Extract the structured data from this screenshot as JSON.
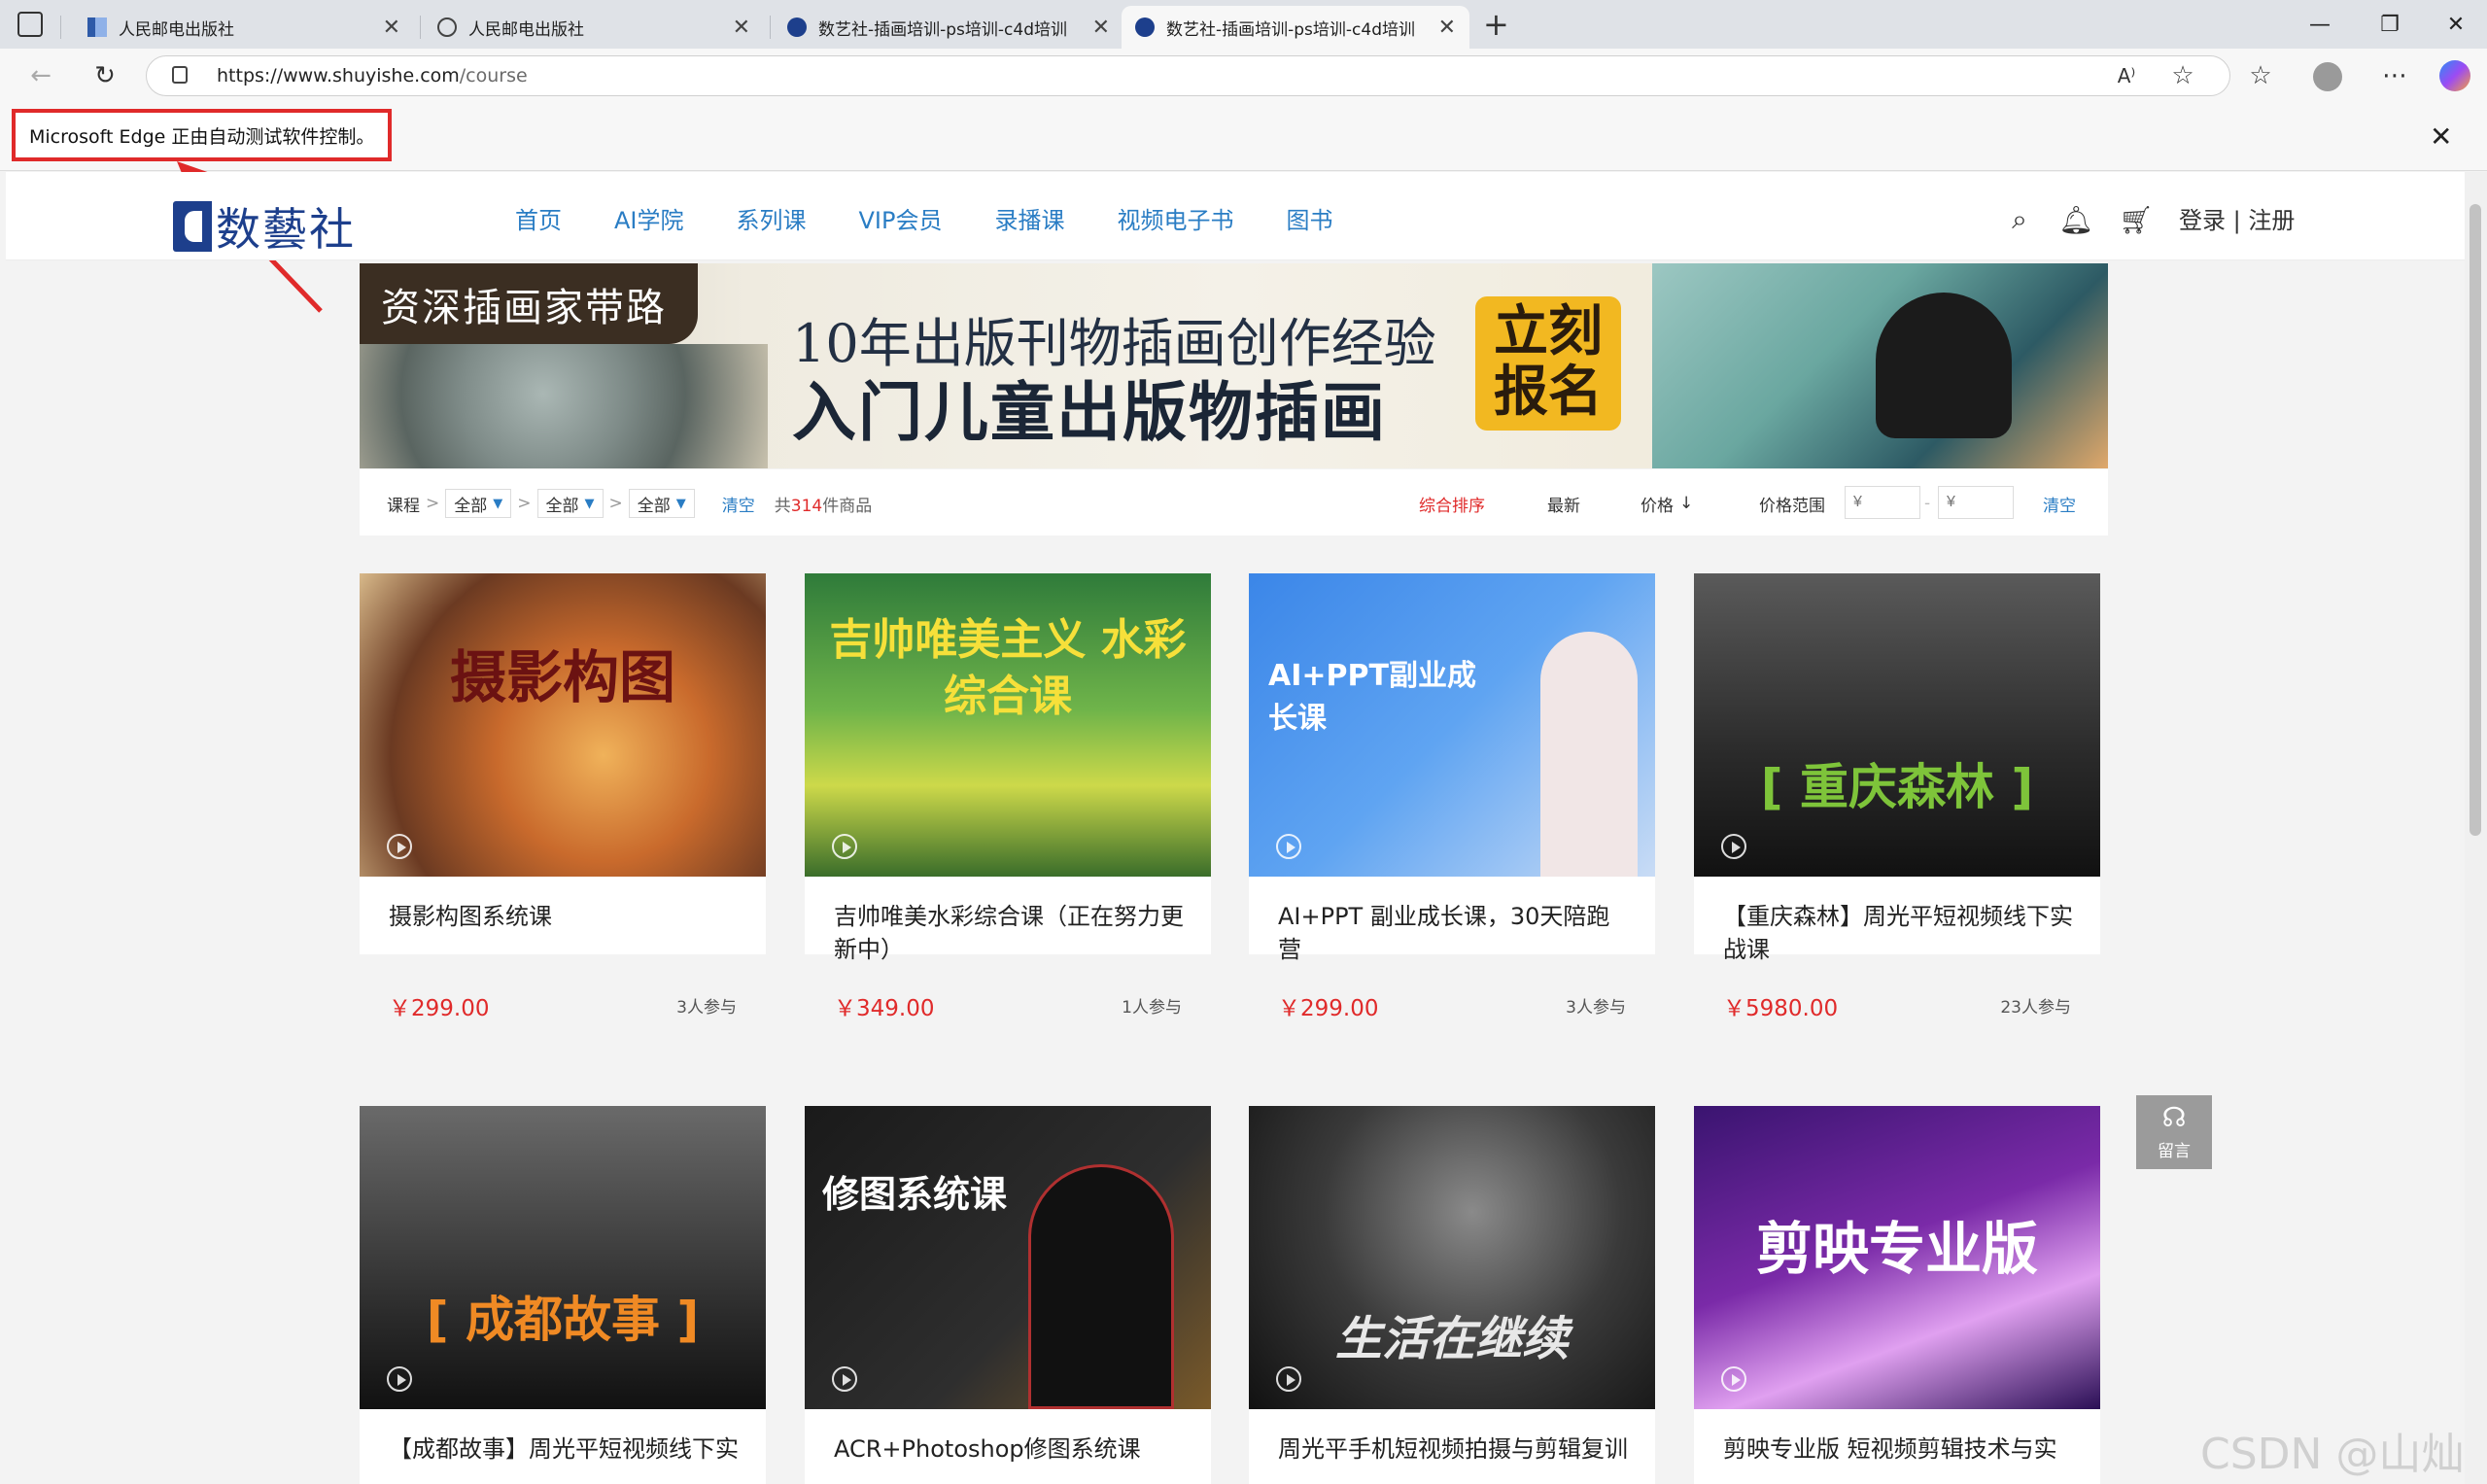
{
  "browser": {
    "tabs": [
      {
        "title": "人民邮电出版社",
        "active": false
      },
      {
        "title": "人民邮电出版社",
        "active": false
      },
      {
        "title": "数艺社-插画培训-ps培训-c4d培训",
        "active": false
      },
      {
        "title": "数艺社-插画培训-ps培训-c4d培训",
        "active": true
      }
    ],
    "url_host": "https://www.shuyishe.com",
    "url_path": "/course",
    "automation_notice": "Microsoft Edge 正由自动测试软件控制。",
    "colors": {
      "annotation": "#e02a2a",
      "tabbar": "#dfe2e7"
    }
  },
  "site": {
    "logo_text": "数藝社",
    "nav": [
      "首页",
      "AI学院",
      "系列课",
      "VIP会员",
      "录播课",
      "视频电子书",
      "图书"
    ],
    "login": "登录 | 注册",
    "accent": "#2a7dc4"
  },
  "banner": {
    "tag": "资深插画家带路",
    "line1": "10年出版刊物插画创作经验",
    "line2": "入门儿童出版物插画",
    "cta_line1": "立刻",
    "cta_line2": "报名"
  },
  "filter": {
    "course_label": "课程",
    "select1": "全部",
    "select2": "全部",
    "select3": "全部",
    "clear": "清空",
    "total_prefix": "共",
    "total_count": "314",
    "total_suffix": "件商品",
    "sort_default": "综合排序",
    "sort_latest": "最新",
    "sort_price": "价格",
    "price_range": "价格范围",
    "price_min_placeholder": "¥",
    "price_max_placeholder": "¥",
    "price_dash": "-",
    "clear2": "清空"
  },
  "courses_row1": [
    {
      "title": "摄影构图系统课",
      "price": "￥299.00",
      "count": "3人参与",
      "thumb_text": "摄影构图"
    },
    {
      "title": "吉帅唯美水彩综合课（正在努力更新中）",
      "price": "￥349.00",
      "count": "1人参与",
      "thumb_text": "吉帅唯美主义 水彩综合课"
    },
    {
      "title": "AI+PPT 副业成长课，30天陪跑营",
      "price": "￥299.00",
      "count": "3人参与",
      "thumb_text": "AI+PPT副业成长课"
    },
    {
      "title": "【重庆森林】周光平短视频线下实战课",
      "price": "￥5980.00",
      "count": "23人参与",
      "thumb_text": "[ 重庆森林 ]"
    }
  ],
  "courses_row2": [
    {
      "title": "【成都故事】周光平短视频线下实战课",
      "thumb_text": "[ 成都故事 ]"
    },
    {
      "title": "ACR+Photoshop修图系统课",
      "thumb_text": "修图系统课"
    },
    {
      "title": "周光平手机短视频拍摄与剪辑复训课程",
      "thumb_text": "生活在继续"
    },
    {
      "title": "剪映专业版 短视频剪辑技术与实战",
      "thumb_text": "剪映专业版"
    }
  ],
  "widget": {
    "message": "留言"
  },
  "watermark": "CSDN @山灿"
}
